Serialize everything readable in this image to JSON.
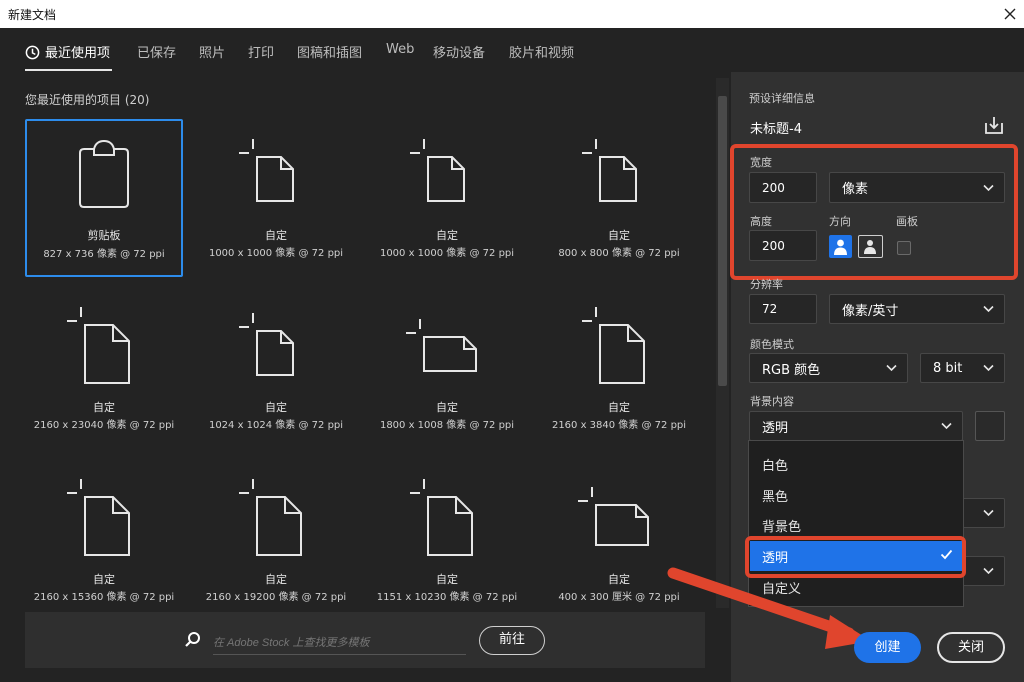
{
  "window": {
    "title": "新建文档"
  },
  "tabs": [
    "最近使用项",
    "已保存",
    "照片",
    "打印",
    "图稿和插图",
    "Web",
    "移动设备",
    "胶片和视频"
  ],
  "recent": {
    "header": "您最近使用的项目 (20)",
    "items": [
      {
        "name": "剪贴板",
        "dims": "827 x 736 像素 @ 72 ppi",
        "selected": true
      },
      {
        "name": "自定",
        "dims": "1000 x 1000 像素 @ 72 ppi"
      },
      {
        "name": "自定",
        "dims": "1000 x 1000 像素 @ 72 ppi"
      },
      {
        "name": "自定",
        "dims": "800 x 800 像素 @ 72 ppi"
      },
      {
        "name": "自定",
        "dims": "2160 x 23040 像素 @ 72 ppi"
      },
      {
        "name": "自定",
        "dims": "1024 x 1024 像素 @ 72 ppi"
      },
      {
        "name": "自定",
        "dims": "1800 x 1008 像素 @ 72 ppi"
      },
      {
        "name": "自定",
        "dims": "2160 x 3840 像素 @ 72 ppi"
      },
      {
        "name": "自定",
        "dims": "2160 x 15360 像素 @ 72 ppi"
      },
      {
        "name": "自定",
        "dims": "2160 x 19200 像素 @ 72 ppi"
      },
      {
        "name": "自定",
        "dims": "1151 x 10230 像素 @ 72 ppi"
      },
      {
        "name": "自定",
        "dims": "400 x 300 厘米 @ 72 ppi"
      }
    ]
  },
  "stock": {
    "placeholder": "在 Adobe Stock 上查找更多模板",
    "go": "前往"
  },
  "details": {
    "section_title": "预设详细信息",
    "doc_name": "未标题-4",
    "width_label": "宽度",
    "width_value": "200",
    "width_unit": "像素",
    "height_label": "高度",
    "height_value": "200",
    "orientation_label": "方向",
    "artboard_label": "画板",
    "resolution_label": "分辨率",
    "resolution_value": "72",
    "resolution_unit": "像素/英寸",
    "color_mode_label": "颜色模式",
    "color_mode": "RGB 颜色",
    "bit_depth": "8 bit",
    "bg_label": "背景内容",
    "bg_value": "透明",
    "bg_options": [
      "白色",
      "黑色",
      "背景色",
      "透明",
      "自定义"
    ]
  },
  "actions": {
    "create": "创建",
    "close": "关闭"
  },
  "colors": {
    "accent": "#1f73e8",
    "highlight": "#e0452d",
    "selected_border": "#2d8ceb"
  }
}
